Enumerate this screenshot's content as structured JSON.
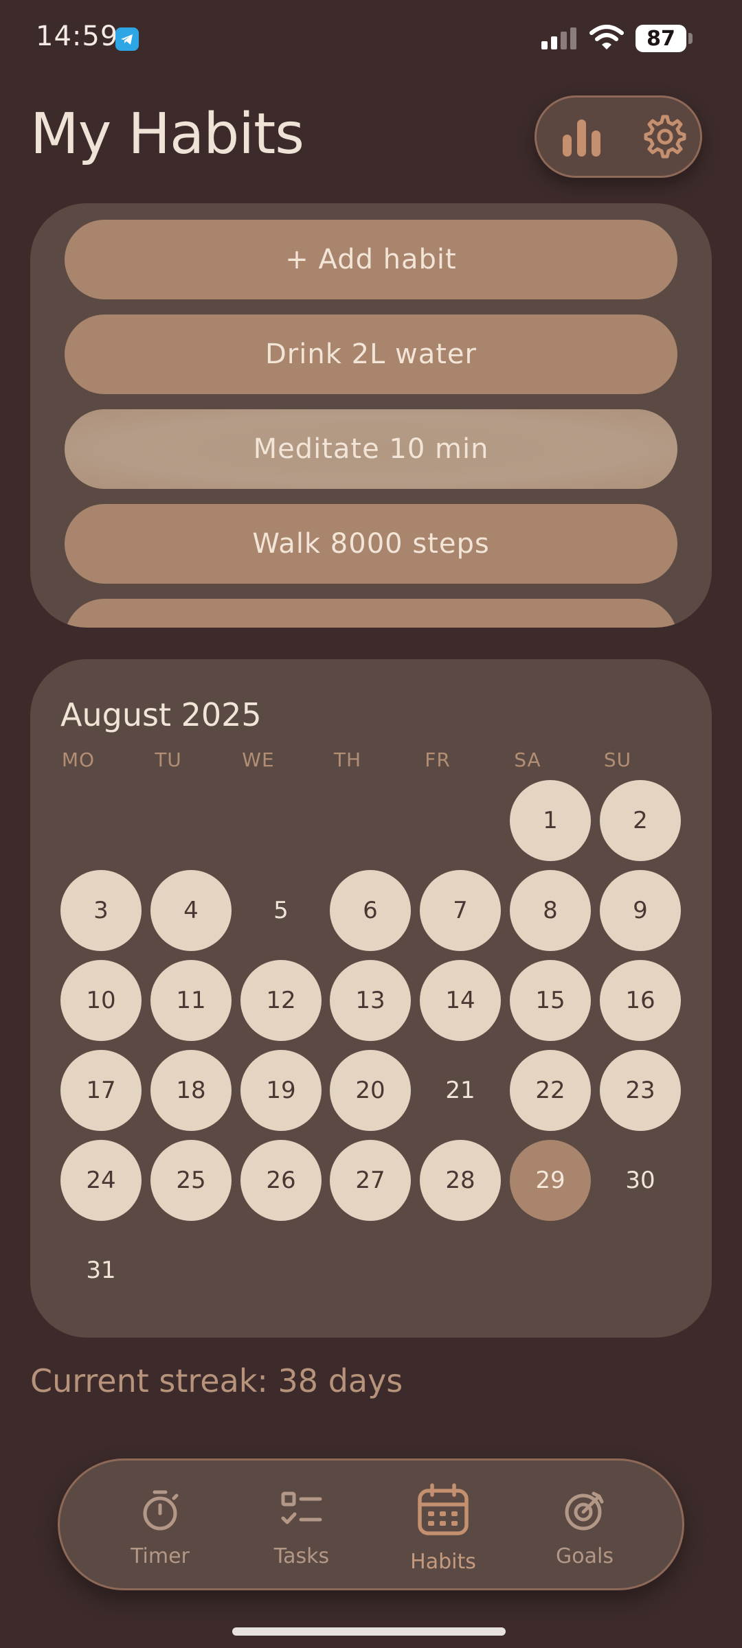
{
  "status_bar": {
    "time": "14:59",
    "battery": "87",
    "app_icon": "telegram-icon"
  },
  "header": {
    "title": "My Habits",
    "stats_icon": "bar-chart-icon",
    "settings_icon": "gear-icon"
  },
  "habits": {
    "add_label": "+ Add habit",
    "items": [
      {
        "label": "Drink 2L water"
      },
      {
        "label": "Meditate 10 min"
      },
      {
        "label": "Walk 8000 steps"
      }
    ]
  },
  "calendar": {
    "month": "August 2025",
    "weekdays": [
      "MO",
      "TU",
      "WE",
      "TH",
      "FR",
      "SA",
      "SU"
    ],
    "first_weekday_index": 5,
    "days_in_month": 31,
    "today": 29,
    "completed_days": [
      1,
      2,
      3,
      4,
      6,
      7,
      8,
      9,
      10,
      11,
      12,
      13,
      14,
      15,
      16,
      17,
      18,
      19,
      20,
      22,
      23,
      24,
      25,
      26,
      27,
      28
    ]
  },
  "streak": {
    "text": "Current streak: 38 days"
  },
  "nav": {
    "items": [
      {
        "label": "Timer",
        "icon": "stopwatch-icon"
      },
      {
        "label": "Tasks",
        "icon": "checklist-icon"
      },
      {
        "label": "Habits",
        "icon": "calendar-icon"
      },
      {
        "label": "Goals",
        "icon": "target-icon"
      }
    ],
    "active": "Habits"
  },
  "colors": {
    "background": "#3d2b2b",
    "card": "#5b4a43",
    "accent": "#a8856c",
    "day_done": "#e3d5c2"
  }
}
